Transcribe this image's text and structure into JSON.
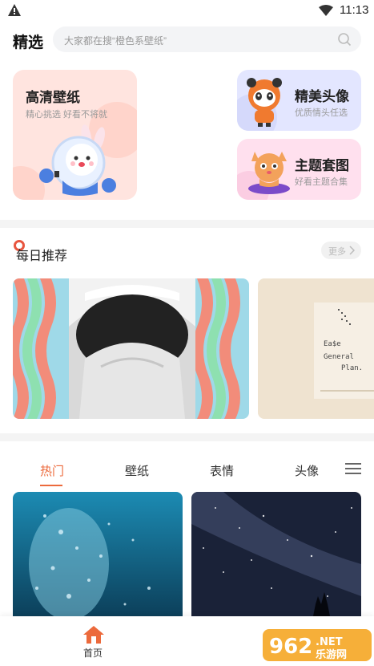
{
  "status_bar": {
    "time": "11:13",
    "warning_icon": "warning-icon",
    "wifi_icon": "wifi-icon"
  },
  "header": {
    "title": "精选",
    "search_placeholder": "大家都在搜“橙色系壁纸”"
  },
  "features": {
    "hd_wallpaper": {
      "title": "高清壁纸",
      "subtitle": "精心挑选 好看不将就"
    },
    "avatar": {
      "title": "精美头像",
      "subtitle": "优质情头任选"
    },
    "theme": {
      "title": "主题套图",
      "subtitle": "好看主题合集"
    }
  },
  "daily": {
    "title": "每日推荐",
    "more_label": "更多"
  },
  "tabs": [
    {
      "label": "热门"
    },
    {
      "label": "壁纸"
    },
    {
      "label": "表情"
    },
    {
      "label": "头像"
    }
  ],
  "bottom_nav": {
    "home_label": "首页"
  },
  "colors": {
    "accent": "#ec6a3c",
    "search_bg": "#f3f4f6",
    "hd_card": "#ffe4df",
    "avatar_card": "#e3e6ff",
    "theme_card": "#ffe0ee"
  }
}
